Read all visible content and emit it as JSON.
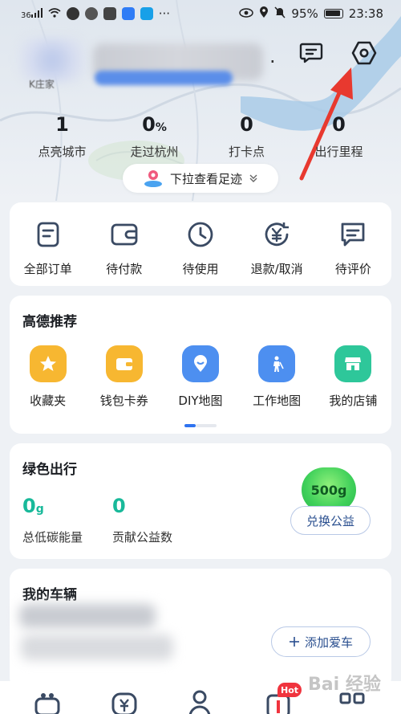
{
  "status_bar": {
    "signal_label": "36",
    "battery_percent": "95%",
    "time": "23:38",
    "more": "···"
  },
  "header": {
    "level_label": "K庄家",
    "dot": "."
  },
  "stats": [
    {
      "value": "1",
      "unit": "",
      "label": "点亮城市"
    },
    {
      "value": "0",
      "unit": "%",
      "label": "走过杭州"
    },
    {
      "value": "0",
      "unit": "",
      "label": "打卡点"
    },
    {
      "value": "0",
      "unit": "",
      "label": "出行里程"
    }
  ],
  "footprint": {
    "label": "下拉查看足迹"
  },
  "orders": [
    {
      "label": "全部订单",
      "icon": "order-list-icon"
    },
    {
      "label": "待付款",
      "icon": "wallet-icon"
    },
    {
      "label": "待使用",
      "icon": "clock-icon"
    },
    {
      "label": "退款/取消",
      "icon": "refund-icon"
    },
    {
      "label": "待评价",
      "icon": "comment-icon"
    }
  ],
  "recommend": {
    "title": "高德推荐",
    "items": [
      {
        "label": "收藏夹",
        "icon": "star-icon",
        "color": "#f7b731"
      },
      {
        "label": "钱包卡券",
        "icon": "wallet-card-icon",
        "color": "#f7b731"
      },
      {
        "label": "DIY地图",
        "icon": "map-pin-icon",
        "color": "#4d8ff0"
      },
      {
        "label": "工作地图",
        "icon": "worker-icon",
        "color": "#4d8ff0"
      },
      {
        "label": "我的店铺",
        "icon": "shop-icon",
        "color": "#2ec79a"
      }
    ]
  },
  "green": {
    "title": "绿色出行",
    "carbon_value": "0",
    "carbon_unit": "g",
    "carbon_label": "总低碳能量",
    "donate_value": "0",
    "donate_label": "贡献公益数",
    "badge": "500g",
    "exchange_button": "兑换公益"
  },
  "vehicle": {
    "title": "我的车辆",
    "add_button": "添加爱车"
  },
  "tabbar": {
    "hot_badge": "Hot"
  },
  "watermark": "Bai 经验",
  "colors": {
    "accent_blue": "#2f73f0",
    "green": "#19b99a",
    "hot_red": "#f0343e",
    "annotation_red": "#e8392f"
  }
}
